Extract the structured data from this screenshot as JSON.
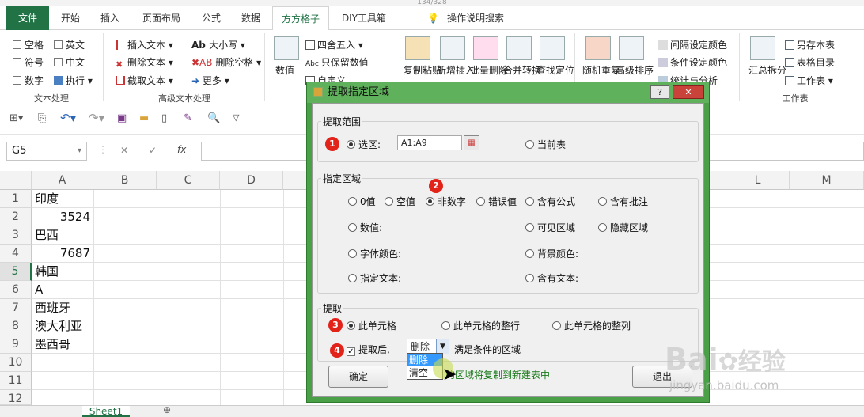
{
  "top_hint": "134/328",
  "tabs": {
    "file": "文件",
    "home": "开始",
    "insert": "插入",
    "layout": "页面布局",
    "formula": "公式",
    "data": "数据",
    "ffgz": "方方格子",
    "diy": "DIY工具箱",
    "tell": "操作说明搜索"
  },
  "ribbon": {
    "text_group": {
      "space": "空格",
      "english": "英文",
      "symbol": "符号",
      "chinese": "中文",
      "digit": "数字",
      "execute": "执行",
      "label": "文本处理"
    },
    "adv_group": {
      "insert_text": "插入文本",
      "delete_text": "删除文本",
      "extract_text": "截取文本",
      "case": "大小写",
      "delete_space": "删除空格",
      "more": "更多",
      "label": "高级文本处理"
    },
    "num_group": {
      "value": "数值",
      "round": "四舍五入",
      "keep_value": "只保留数值",
      "custom": "自定义"
    },
    "mid": {
      "copy_paste": "复制粘贴",
      "add_insert": "新增插入",
      "batch_delete": "批量删除",
      "merge_convert": "合并转换",
      "lookup": "查找定位",
      "random_repeat": "随机重复",
      "advanced_sort": "高级排序"
    },
    "color": {
      "interval_color": "间隔设定颜色",
      "cond_color": "条件设定颜色",
      "stats": "统计与分析"
    },
    "sheet": {
      "summary_split": "汇总拆分",
      "save_as": "另存本表",
      "sheet_list": "表格目录",
      "worksheet": "工作表",
      "label": "工作表"
    }
  },
  "formula_bar": {
    "namebox": "G5",
    "fx": "fx"
  },
  "columns": [
    "A",
    "B",
    "C",
    "D",
    "L",
    "M"
  ],
  "rows": [
    "1",
    "2",
    "3",
    "4",
    "5",
    "6",
    "7",
    "8",
    "9",
    "10",
    "11",
    "12"
  ],
  "cells": {
    "a1": "印度",
    "a2": "3524",
    "a3": "巴西",
    "a4": "7687",
    "a5": "韩国",
    "a6": "A",
    "a7": "西班牙",
    "a8": "澳大利亚",
    "a9": "墨西哥"
  },
  "sheet_tab": "Sheet1",
  "dialog": {
    "title": "提取指定区域",
    "help": "?",
    "range_legend": "提取范围",
    "selection": "选区:",
    "range_value": "A1:A9",
    "current_sheet": "当前表",
    "area_legend": "指定区域",
    "zero": "0值",
    "blank": "空值",
    "nonnum": "非数字",
    "error": "错误值",
    "has_formula": "含有公式",
    "has_comment": "含有批注",
    "numval": "数值:",
    "visible": "可见区域",
    "hidden": "隐藏区域",
    "font_color": "字体颜色:",
    "bg_color": "背景颜色:",
    "spec_text": "指定文本:",
    "contains_text": "含有文本:",
    "extract_legend": "提取",
    "this_cell": "此单元格",
    "this_row": "此单元格的整行",
    "this_col": "此单元格的整列",
    "after_extract": "提取后,",
    "action_selected": "删除",
    "after_label": "满足条件的区域",
    "options": [
      "删除",
      "清空"
    ],
    "note": "的区域将复制到新建表中",
    "ok": "确定",
    "exit": "退出"
  },
  "badges": [
    "1",
    "2",
    "3",
    "4"
  ],
  "watermark": {
    "brand": "Bai",
    "brand2": "经验",
    "url": "jingyan.baidu.com"
  }
}
